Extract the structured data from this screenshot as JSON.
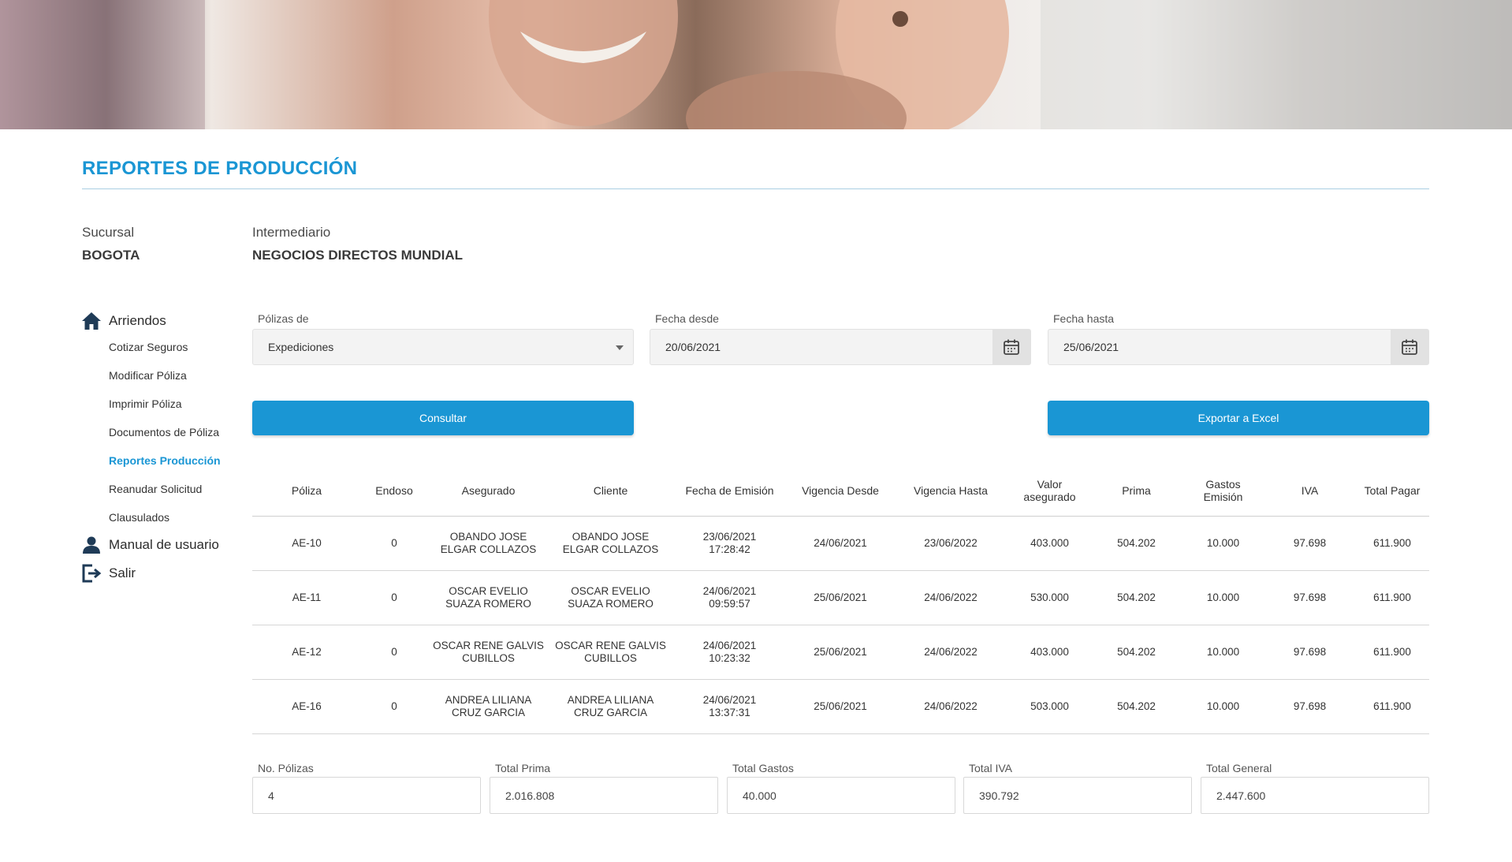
{
  "page": {
    "title": "REPORTES DE PRODUCCIÓN"
  },
  "meta": {
    "sucursal_label": "Sucursal",
    "sucursal_value": "BOGOTA",
    "intermediario_label": "Intermediario",
    "intermediario_value": "NEGOCIOS DIRECTOS MUNDIAL"
  },
  "sidebar": {
    "section": "Arriendos",
    "items": [
      {
        "label": "Cotizar Seguros"
      },
      {
        "label": "Modificar Póliza"
      },
      {
        "label": "Imprimir Póliza"
      },
      {
        "label": "Documentos de Póliza"
      },
      {
        "label": "Reportes Producción"
      },
      {
        "label": "Reanudar Solicitud"
      },
      {
        "label": "Clausulados"
      }
    ],
    "manual_label": "Manual de usuario",
    "logout_label": "Salir"
  },
  "filters": {
    "polizas_label": "Pólizas de",
    "polizas_value": "Expediciones",
    "desde_label": "Fecha desde",
    "desde_value": "20/06/2021",
    "hasta_label": "Fecha hasta",
    "hasta_value": "25/06/2021"
  },
  "buttons": {
    "consultar": "Consultar",
    "exportar": "Exportar a Excel"
  },
  "table": {
    "headers": [
      [
        "Póliza"
      ],
      [
        "Endoso"
      ],
      [
        "Asegurado"
      ],
      [
        "Cliente"
      ],
      [
        "Fecha de Emisión"
      ],
      [
        "Vigencia Desde"
      ],
      [
        "Vigencia Hasta"
      ],
      [
        "Valor",
        "asegurado"
      ],
      [
        "Prima"
      ],
      [
        "Gastos",
        "Emisión"
      ],
      [
        "IVA"
      ],
      [
        "Total Pagar"
      ]
    ],
    "rows": [
      [
        [
          "AE-10"
        ],
        [
          "0"
        ],
        [
          "OBANDO JOSE",
          "ELGAR COLLAZOS"
        ],
        [
          "OBANDO JOSE",
          "ELGAR COLLAZOS"
        ],
        [
          "23/06/2021",
          "17:28:42"
        ],
        [
          "24/06/2021"
        ],
        [
          "23/06/2022"
        ],
        [
          "403.000"
        ],
        [
          "504.202"
        ],
        [
          "10.000"
        ],
        [
          "97.698"
        ],
        [
          "611.900"
        ]
      ],
      [
        [
          "AE-11"
        ],
        [
          "0"
        ],
        [
          "OSCAR EVELIO",
          "SUAZA ROMERO"
        ],
        [
          "OSCAR EVELIO",
          "SUAZA ROMERO"
        ],
        [
          "24/06/2021",
          "09:59:57"
        ],
        [
          "25/06/2021"
        ],
        [
          "24/06/2022"
        ],
        [
          "530.000"
        ],
        [
          "504.202"
        ],
        [
          "10.000"
        ],
        [
          "97.698"
        ],
        [
          "611.900"
        ]
      ],
      [
        [
          "AE-12"
        ],
        [
          "0"
        ],
        [
          "OSCAR RENE GALVIS",
          "CUBILLOS"
        ],
        [
          "OSCAR RENE GALVIS",
          "CUBILLOS"
        ],
        [
          "24/06/2021",
          "10:23:32"
        ],
        [
          "25/06/2021"
        ],
        [
          "24/06/2022"
        ],
        [
          "403.000"
        ],
        [
          "504.202"
        ],
        [
          "10.000"
        ],
        [
          "97.698"
        ],
        [
          "611.900"
        ]
      ],
      [
        [
          "AE-16"
        ],
        [
          "0"
        ],
        [
          "ANDREA LILIANA",
          "CRUZ GARCIA"
        ],
        [
          "ANDREA LILIANA",
          "CRUZ GARCIA"
        ],
        [
          "24/06/2021",
          "13:37:31"
        ],
        [
          "25/06/2021"
        ],
        [
          "24/06/2022"
        ],
        [
          "503.000"
        ],
        [
          "504.202"
        ],
        [
          "10.000"
        ],
        [
          "97.698"
        ],
        [
          "611.900"
        ]
      ]
    ]
  },
  "totals": [
    {
      "label": "No. Pólizas",
      "value": "4"
    },
    {
      "label": "Total Prima",
      "value": "2.016.808"
    },
    {
      "label": "Total Gastos",
      "value": "40.000"
    },
    {
      "label": "Total IVA",
      "value": "390.792"
    },
    {
      "label": "Total General",
      "value": "2.447.600"
    }
  ],
  "colors": {
    "accent": "#1a96d4",
    "sidebar_icon": "#1f3b57"
  }
}
